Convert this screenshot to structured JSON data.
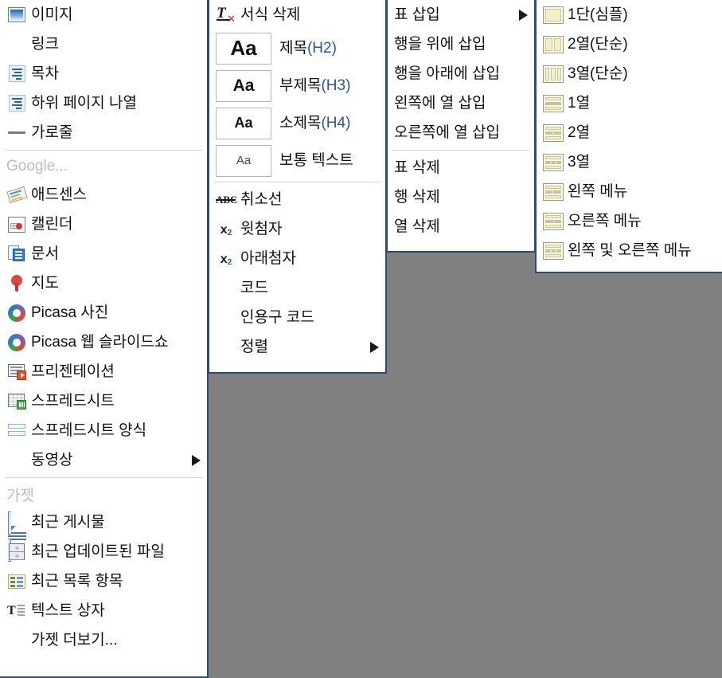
{
  "menus": {
    "insert": {
      "items": [
        {
          "label": "이미지",
          "icon": "image-icon"
        },
        {
          "label": "링크",
          "icon": "none"
        },
        {
          "label": "목차",
          "icon": "toc-icon"
        },
        {
          "label": "하위 페이지 나열",
          "icon": "toc-icon"
        },
        {
          "label": "가로줄",
          "icon": "horizontal-rule-icon"
        }
      ],
      "google_group": {
        "title": "Google...",
        "items": [
          {
            "label": "애드센스",
            "icon": "adsense-icon"
          },
          {
            "label": "캘린더",
            "icon": "calendar-icon"
          },
          {
            "label": "문서",
            "icon": "document-icon"
          },
          {
            "label": "지도",
            "icon": "map-pin-icon"
          },
          {
            "label": "Picasa 사진",
            "icon": "picasa-icon"
          },
          {
            "label": "Picasa 웹 슬라이드쇼",
            "icon": "picasa-icon"
          },
          {
            "label": "프리젠테이션",
            "icon": "presentation-icon"
          },
          {
            "label": "스프레드시트",
            "icon": "spreadsheet-icon"
          },
          {
            "label": "스프레드시트 양식",
            "icon": "form-icon"
          },
          {
            "label": "동영상",
            "icon": "none",
            "submenu": true
          }
        ]
      },
      "gadget_group": {
        "title": "가젯",
        "items": [
          {
            "label": "최근 게시물",
            "icon": "recent-post-icon"
          },
          {
            "label": "최근 업데이트된 파일",
            "icon": "recent-file-icon"
          },
          {
            "label": "최근 목록 항목",
            "icon": "recent-list-icon"
          },
          {
            "label": "텍스트 상자",
            "icon": "text-box-icon"
          },
          {
            "label": "가젯 더보기...",
            "icon": "none"
          }
        ]
      }
    },
    "format": {
      "clear": {
        "label": "서식 삭제",
        "icon": "clear-format-icon"
      },
      "styles": [
        {
          "sample": "Aa",
          "label": "제목",
          "tag": "(H2)",
          "size": "h2"
        },
        {
          "sample": "Aa",
          "label": "부제목",
          "tag": "(H3)",
          "size": "h3"
        },
        {
          "sample": "Aa",
          "label": "소제목",
          "tag": "(H4)",
          "size": "h4"
        },
        {
          "sample": "Aa",
          "label": "보통 텍스트",
          "tag": "",
          "size": "normal"
        }
      ],
      "items": [
        {
          "label": "취소선",
          "icon": "strikethrough-icon"
        },
        {
          "label": "윗첨자",
          "icon": "superscript-icon"
        },
        {
          "label": "아래첨자",
          "icon": "subscript-icon"
        },
        {
          "label": "코드",
          "icon": "none"
        },
        {
          "label": "인용구 코드",
          "icon": "none"
        },
        {
          "label": "정렬",
          "icon": "none",
          "submenu": true
        }
      ]
    },
    "table": {
      "group1": [
        {
          "label": "표 삽입",
          "submenu": true
        },
        {
          "label": "행을 위에 삽입",
          "submenu": false
        },
        {
          "label": "행을 아래에 삽입",
          "submenu": false
        },
        {
          "label": "왼쪽에 열 삽입",
          "submenu": false
        },
        {
          "label": "오른쪽에 열 삽입",
          "submenu": false
        }
      ],
      "group2": [
        {
          "label": "표 삭제"
        },
        {
          "label": "행 삭제"
        },
        {
          "label": "열 삭제"
        }
      ]
    },
    "layout": {
      "items": [
        {
          "label": "1단(심플)",
          "icon": "layout-1col-simple"
        },
        {
          "label": "2열(단순)",
          "icon": "layout-2col-simple"
        },
        {
          "label": "3열(단순)",
          "icon": "layout-3col-simple"
        },
        {
          "label": "1열",
          "icon": "layout-1col-header"
        },
        {
          "label": "2열",
          "icon": "layout-2col-header"
        },
        {
          "label": "3열",
          "icon": "layout-3col-header"
        },
        {
          "label": "왼쪽 메뉴",
          "icon": "layout-left-menu"
        },
        {
          "label": "오른쪽 메뉴",
          "icon": "layout-right-menu"
        },
        {
          "label": "왼쪽 및 오른쪽 메뉴",
          "icon": "layout-both-menu"
        }
      ]
    }
  },
  "colors": {
    "menu_border": "#2c4a7c",
    "background": "#808080",
    "group_title": "#bdbdbd",
    "tag_blue": "#2a55a3"
  }
}
